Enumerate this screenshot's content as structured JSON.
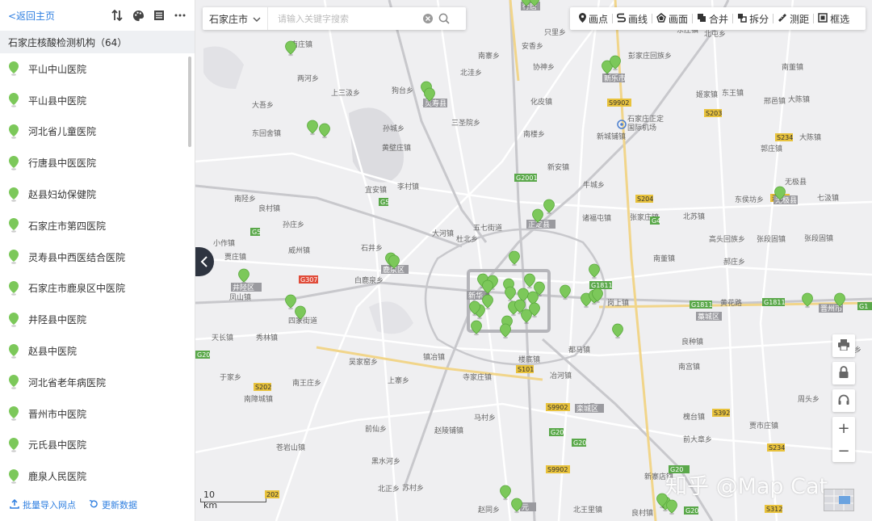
{
  "sidebar": {
    "back_label": "<返回主页",
    "group_title": "石家庄核酸检测机构（64）",
    "items": [
      {
        "label": "平山中山医院"
      },
      {
        "label": "平山县中医院"
      },
      {
        "label": "河北省儿童医院"
      },
      {
        "label": "行唐县中医医院"
      },
      {
        "label": "赵县妇幼保健院"
      },
      {
        "label": "石家庄市第四医院"
      },
      {
        "label": "灵寿县中西医结合医院"
      },
      {
        "label": "石家庄市鹿泉区中医院"
      },
      {
        "label": "井陉县中医院"
      },
      {
        "label": "赵县中医院"
      },
      {
        "label": "河北省老年病医院"
      },
      {
        "label": "晋州市中医院"
      },
      {
        "label": "元氏县中医院"
      },
      {
        "label": "鹿泉人民医院"
      }
    ],
    "footer": {
      "import_label": "批量导入网点",
      "refresh_label": "更新数据"
    }
  },
  "search": {
    "city": "石家庄市",
    "placeholder": "请输入关键字搜索"
  },
  "toolbar": {
    "point": "画点",
    "line": "画线",
    "polygon": "画面",
    "merge": "合并",
    "split": "拆分",
    "measure": "测距",
    "select": "框选"
  },
  "scale_label": "10 km",
  "watermark": "知乎 @Map Cat",
  "map_labels": [
    {
      "t": "南庄镇"
    },
    {
      "t": "两河乡"
    },
    {
      "t": "大吾乡"
    },
    {
      "t": "东回舍镇"
    },
    {
      "t": "上三汲乡"
    },
    {
      "t": "狗台乡"
    },
    {
      "t": "灵寿县"
    },
    {
      "t": "北洼乡"
    },
    {
      "t": "南寨乡"
    },
    {
      "t": "安香乡"
    },
    {
      "t": "协神乡"
    },
    {
      "t": "化皮镇"
    },
    {
      "t": "三圣院乡"
    },
    {
      "t": "南楼乡"
    },
    {
      "t": "新城铺镇"
    },
    {
      "t": "石家庄正定国际机场"
    },
    {
      "t": "彭家庄回族乡"
    },
    {
      "t": "南董镇"
    },
    {
      "t": "东王镇"
    },
    {
      "t": "姬家镇"
    },
    {
      "t": "邢邑镇"
    },
    {
      "t": "大陈镇"
    },
    {
      "t": "郭庄镇"
    },
    {
      "t": "无极县"
    },
    {
      "t": "七汲镇"
    },
    {
      "t": "牛城乡"
    },
    {
      "t": "张家庄镇"
    },
    {
      "t": "北苏镇"
    },
    {
      "t": "张段固镇"
    },
    {
      "t": "高头回族乡"
    },
    {
      "t": "郝庄乡"
    },
    {
      "t": "岗上镇"
    },
    {
      "t": "晋州市"
    },
    {
      "t": "黄花路"
    },
    {
      "t": "良种镇"
    },
    {
      "t": "南宫镇"
    },
    {
      "t": "周头乡"
    },
    {
      "t": "槐台镇"
    },
    {
      "t": "前大章乡"
    },
    {
      "t": "贾市庄镇"
    },
    {
      "t": "赵县"
    },
    {
      "t": "新寨店镇"
    },
    {
      "t": "北王里镇"
    },
    {
      "t": "南柏舍镇"
    },
    {
      "t": "马村乡"
    },
    {
      "t": "赵陵铺镇"
    },
    {
      "t": "苏村乡"
    },
    {
      "t": "赵同乡"
    },
    {
      "t": "元氏县"
    },
    {
      "t": "前仙乡"
    },
    {
      "t": "黑水河乡"
    },
    {
      "t": "苍岩山镇"
    },
    {
      "t": "南障城镇"
    },
    {
      "t": "北正乡"
    },
    {
      "t": "于家乡"
    },
    {
      "t": "天长镇"
    },
    {
      "t": "秀林镇"
    },
    {
      "t": "吴家窑乡"
    },
    {
      "t": "上寨乡"
    },
    {
      "t": "南王庄乡"
    },
    {
      "t": "镇冶镇"
    },
    {
      "t": "寺家庄镇"
    },
    {
      "t": "楼底镇"
    },
    {
      "t": "冶河镇"
    },
    {
      "t": "都马镇"
    },
    {
      "t": "井陉矿区"
    },
    {
      "t": "凤山镇"
    },
    {
      "t": "贾庄镇"
    },
    {
      "t": "小作镇"
    },
    {
      "t": "南陉乡"
    },
    {
      "t": "良村镇"
    },
    {
      "t": "孙庄乡"
    },
    {
      "t": "威州镇"
    },
    {
      "t": "白鹿泉乡"
    },
    {
      "t": "石井乡"
    },
    {
      "t": "鹿泉区"
    },
    {
      "t": "大河镇"
    },
    {
      "t": "五七街道"
    },
    {
      "t": "杜北乡"
    },
    {
      "t": "宜安镇"
    },
    {
      "t": "李村镇"
    },
    {
      "t": "黄壁庄镇"
    },
    {
      "t": "平山县"
    },
    {
      "t": "新安镇"
    },
    {
      "t": "诸福屯镇"
    },
    {
      "t": "正定镇"
    },
    {
      "t": "只里乡"
    },
    {
      "t": "北屯乡"
    },
    {
      "t": "杜固镇"
    },
    {
      "t": "深泽县"
    },
    {
      "t": "北双乡"
    },
    {
      "t": "张家庄村"
    },
    {
      "t": "十里铺乡"
    },
    {
      "t": "高碑店乡"
    }
  ]
}
